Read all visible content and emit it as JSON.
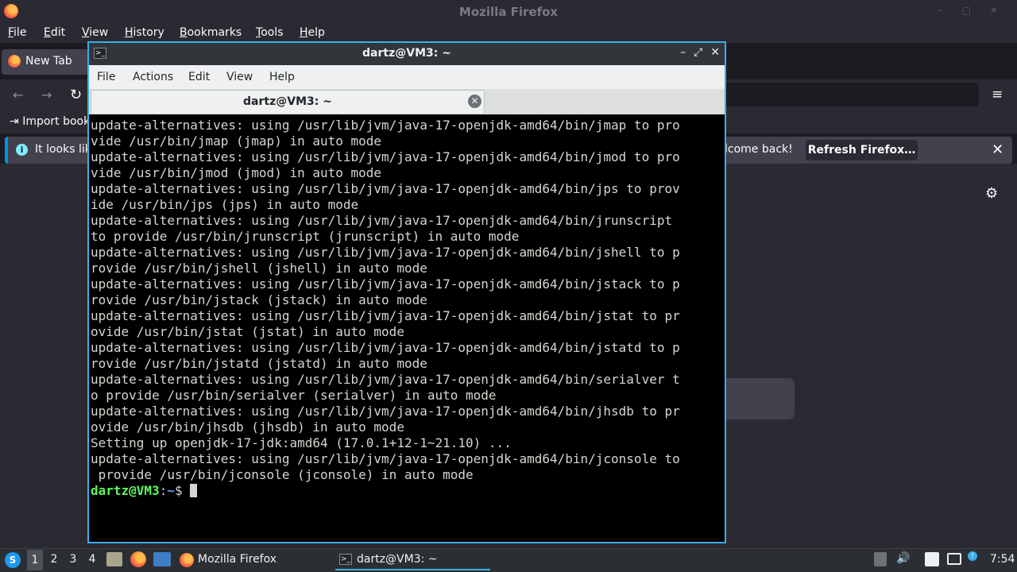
{
  "firefox": {
    "title": "Mozilla Firefox",
    "menu": [
      "File",
      "Edit",
      "View",
      "History",
      "Bookmarks",
      "Tools",
      "Help"
    ],
    "menu_accel": [
      "F",
      "E",
      "V",
      "H",
      "B",
      "T",
      "H"
    ],
    "tab_label": "New Tab",
    "import_bookmarks": "Import book",
    "notice_left": "It looks lik",
    "notice_right": "lcome back!",
    "refresh_button": "Refresh Firefox…",
    "icons": {
      "back": "←",
      "forward": "→",
      "reload": "↻",
      "menu": "≡",
      "close": "✕",
      "gear": "⚙",
      "info": "i"
    }
  },
  "terminal": {
    "title": "dartz@VM3: ~",
    "menu": [
      "File",
      "Actions",
      "Edit",
      "View",
      "Help"
    ],
    "tab_label": "dartz@VM3: ~",
    "output_lines": [
      "update-alternatives: using /usr/lib/jvm/java-17-openjdk-amd64/bin/jmap to pro",
      "vide /usr/bin/jmap (jmap) in auto mode",
      "update-alternatives: using /usr/lib/jvm/java-17-openjdk-amd64/bin/jmod to pro",
      "vide /usr/bin/jmod (jmod) in auto mode",
      "update-alternatives: using /usr/lib/jvm/java-17-openjdk-amd64/bin/jps to prov",
      "ide /usr/bin/jps (jps) in auto mode",
      "update-alternatives: using /usr/lib/jvm/java-17-openjdk-amd64/bin/jrunscript",
      "to provide /usr/bin/jrunscript (jrunscript) in auto mode",
      "update-alternatives: using /usr/lib/jvm/java-17-openjdk-amd64/bin/jshell to p",
      "rovide /usr/bin/jshell (jshell) in auto mode",
      "update-alternatives: using /usr/lib/jvm/java-17-openjdk-amd64/bin/jstack to p",
      "rovide /usr/bin/jstack (jstack) in auto mode",
      "update-alternatives: using /usr/lib/jvm/java-17-openjdk-amd64/bin/jstat to pr",
      "ovide /usr/bin/jstat (jstat) in auto mode",
      "update-alternatives: using /usr/lib/jvm/java-17-openjdk-amd64/bin/jstatd to p",
      "rovide /usr/bin/jstatd (jstatd) in auto mode",
      "update-alternatives: using /usr/lib/jvm/java-17-openjdk-amd64/bin/serialver t",
      "o provide /usr/bin/serialver (serialver) in auto mode",
      "update-alternatives: using /usr/lib/jvm/java-17-openjdk-amd64/bin/jhsdb to pr",
      "ovide /usr/bin/jhsdb (jhsdb) in auto mode",
      "Setting up openjdk-17-jdk:amd64 (17.0.1+12-1~21.10) ...",
      "update-alternatives: using /usr/lib/jvm/java-17-openjdk-amd64/bin/jconsole to",
      " provide /usr/bin/jconsole (jconsole) in auto mode"
    ],
    "prompt": {
      "user": "dartz@VM3",
      "sep": ":",
      "path": "~",
      "symbol": "$ "
    },
    "icons": {
      "minimize": "–",
      "maximize": "⤢",
      "close": "✕",
      "tab_close": "✕",
      "app": ">_"
    }
  },
  "taskbar": {
    "workspaces": [
      "1",
      "2",
      "3",
      "4"
    ],
    "active_workspace": "1",
    "tasks": [
      "Mozilla Firefox",
      "dartz@VM3: ~"
    ],
    "clock": "7:54",
    "icons": {
      "start": "S",
      "volume": "🔊",
      "notification": "!"
    }
  }
}
